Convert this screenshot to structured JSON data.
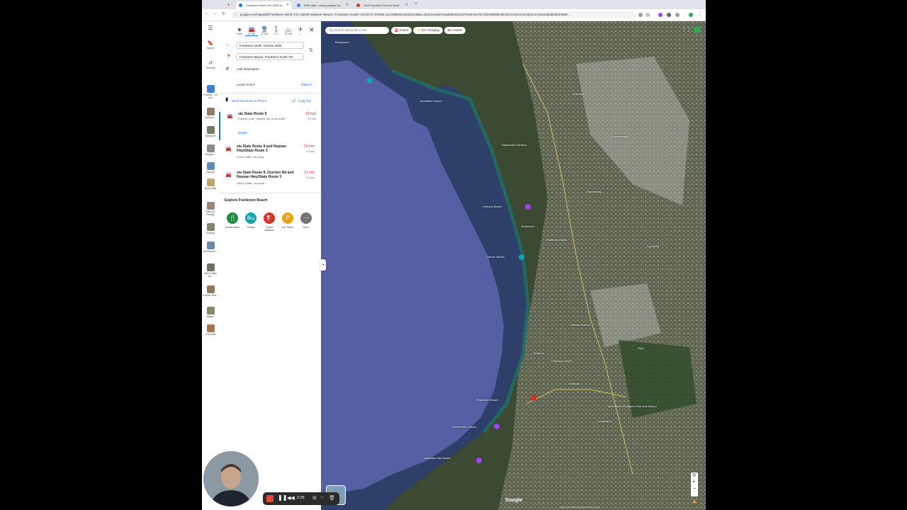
{
  "browser": {
    "tabs": [
      {
        "label": "Frankston North VIC 3200 to...",
        "active": true,
        "color": "#1a73e8"
      },
      {
        "label": "DSR data - zoning supply an...",
        "active": false,
        "color": "#4285f4"
      },
      {
        "label": "Sold Property Prices & Aucti...",
        "active": false,
        "color": "#d93025"
      }
    ],
    "url": "google.com/maps/dir/Frankston+North+VIC+3200/Frankston+Beach,+Frankston+South+VIC/@-37.976328,144.9985254,59342m/data=!3m2!1e3!5e0x6ad6d0d3313979139:0xe7571fac09b3de0!8m!4m14!4m13!1m5!1m1!1s0x6ad6d0d3313589..."
  },
  "rail": {
    "menu_icon": "menu-icon",
    "items": [
      {
        "label": "Saved",
        "icon": "bookmark-icon"
      },
      {
        "label": "Recents",
        "icon": "history-icon"
      },
      {
        "label": "Frankst... 43 min",
        "thumb": "#3f7fd9"
      },
      {
        "label": "Melbour...",
        "thumb": "#8a7f6a"
      },
      {
        "label": "Brisbane",
        "thumb": "#6f7d63"
      },
      {
        "label": "Singapo...",
        "thumb": "#8b8d93"
      },
      {
        "label": "Sydney",
        "thumb": "#5e8cb8"
      },
      {
        "label": "Byron Bay",
        "thumb": "#b9a36f"
      },
      {
        "label": "Tobacco Grange",
        "thumb": "#9a8576"
      },
      {
        "label": "Gunnya",
        "thumb": "#7d8a6a"
      },
      {
        "label": "54 Welcom...",
        "thumb": "#6a88a8"
      },
      {
        "label": "Mash Villas by...",
        "thumb": "#6b7360"
      },
      {
        "label": "Empire Awa...",
        "thumb": "#8d7a5c"
      },
      {
        "label": "Aligarh",
        "thumb": "#7e8c66"
      },
      {
        "label": "Chirchilla",
        "thumb": "#a7764d"
      }
    ]
  },
  "panel": {
    "modes": [
      {
        "label": "Best",
        "icon": "diamond-icon"
      },
      {
        "label": "10 min",
        "icon": "car-icon"
      },
      {
        "label": "31 min",
        "icon": "transit-icon"
      },
      {
        "label": "1 h",
        "icon": "walk-icon"
      },
      {
        "label": "15 min",
        "icon": "bike-icon"
      },
      {
        "label": "—",
        "icon": "flight-icon"
      }
    ],
    "origin": "Frankston North, Victoria 3200",
    "destination": "Frankston Beach, Frankston South VIC",
    "add_destination": "Add destination",
    "leave_now": "Leave now",
    "options": "Options",
    "send_directions": "Send directions to iPhone",
    "copy_link": "Copy link",
    "routes": [
      {
        "title": "via State Route 9",
        "time": "10 min",
        "dist": "4.2 km",
        "sub": "Fastest route, despite the usual traffic",
        "details": "Details"
      },
      {
        "title": "via State Route 9 and Nepean Hwy/State Route 3",
        "time": "10 min",
        "dist": "4.3 km",
        "sub": "Some traffic, as usual"
      },
      {
        "title": "via State Route 9, Overton Rd and Nepean Hwy/State Route 3",
        "time": "11 min",
        "dist": "4.3 km",
        "sub": "Heavy traffic, as usual"
      }
    ],
    "explore_title": "Explore Frankston Beach",
    "explore": [
      {
        "label": "Restaurants",
        "color": "#1e8e3e",
        "glyph": "🍴"
      },
      {
        "label": "Hotels",
        "color": "#12a4af",
        "glyph": "▭"
      },
      {
        "label": "Petrol stations",
        "color": "#d93025",
        "glyph": "⛽"
      },
      {
        "label": "Car Parks",
        "color": "#e8a317",
        "glyph": "P"
      },
      {
        "label": "More",
        "color": "#70757a",
        "glyph": "⋯"
      }
    ]
  },
  "map": {
    "search_placeholder": "Search along the route",
    "chips": [
      "Petrol",
      "EV charging",
      "Hotels"
    ],
    "labels": [
      "Blairgowrie",
      "Mordialloc Beach",
      "Aspendale Gardens",
      "Chelsea Beach",
      "Bonbeach",
      "Carrum Beach",
      "Seaford",
      "Frankston North",
      "Frankston Beach",
      "Olivers Hill Lookout",
      "Canadian Bay Beach",
      "Braeside",
      "Dandenong",
      "Patterson Lakes",
      "Skye",
      "Carrum Downs",
      "Langwarrin",
      "McClelland Sculpture Park and Gallery",
      "Karingal",
      "Lyndhurst",
      "Keysborough"
    ],
    "google": "Google",
    "attribution": "Map data ©2025   Map data ©2025 Google"
  },
  "recorder": {
    "time": "2:25"
  }
}
